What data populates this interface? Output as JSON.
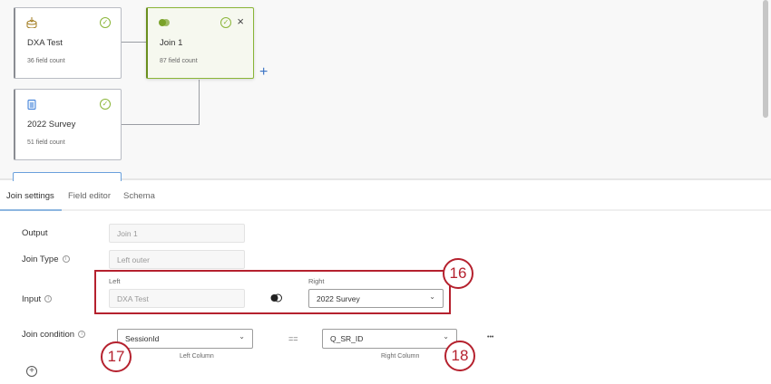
{
  "canvas": {
    "nodes": [
      {
        "title": "DXA Test",
        "sub": "36 field count",
        "icon": "dataset-icon"
      },
      {
        "title": "Join 1",
        "sub": "87 field count",
        "icon": "join-icon"
      },
      {
        "title": "2022 Survey",
        "sub": "51 field count",
        "icon": "survey-icon"
      }
    ],
    "add_symbol": "+"
  },
  "tabs": [
    "Join settings",
    "Field editor",
    "Schema"
  ],
  "form": {
    "output_label": "Output",
    "output_value": "Join 1",
    "join_type_label": "Join Type",
    "join_type_value": "Left outer",
    "input_label": "Input",
    "left_label": "Left",
    "left_value": "DXA Test",
    "right_label": "Right",
    "right_value": "2022 Survey",
    "join_condition_label": "Join condition",
    "left_column": "SessionId",
    "operator": "==",
    "right_column": "Q_SR_ID",
    "left_column_caption": "Left Column",
    "right_column_caption": "Right Column",
    "more": "•••"
  },
  "annotations": [
    "16",
    "17",
    "18"
  ],
  "colors": {
    "accent": "#8ab537",
    "annotation": "#b5212e"
  }
}
